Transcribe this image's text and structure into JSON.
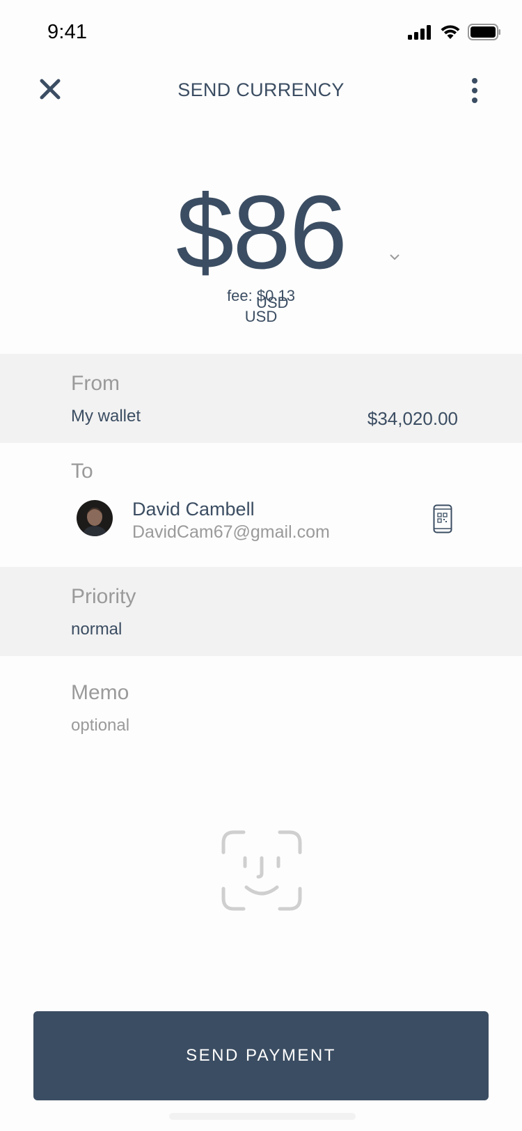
{
  "status_bar": {
    "time": "9:41"
  },
  "nav": {
    "title": "SEND CURRENCY",
    "close_icon": "close-icon",
    "more_icon": "more-vertical-icon"
  },
  "amount": {
    "value": "$86",
    "currency_hint": "USD",
    "fee_line1": "fee: $0.13",
    "fee_line2": "USD"
  },
  "from": {
    "label": "From",
    "value": "My wallet",
    "balance": "$34,020.00"
  },
  "to": {
    "label": "To",
    "name": "David Cambell",
    "email": "DavidCam67@gmail.com",
    "qr_icon": "qr-phone-icon"
  },
  "priority": {
    "label": "Priority",
    "value": "normal"
  },
  "memo": {
    "label": "Memo",
    "placeholder": "optional"
  },
  "faceid_icon": "face-id-icon",
  "send_button": {
    "label": "SEND PAYMENT"
  },
  "colors": {
    "primary": "#3b4d62",
    "muted": "#9a9a9a",
    "row_alt": "#f2f2f2"
  }
}
